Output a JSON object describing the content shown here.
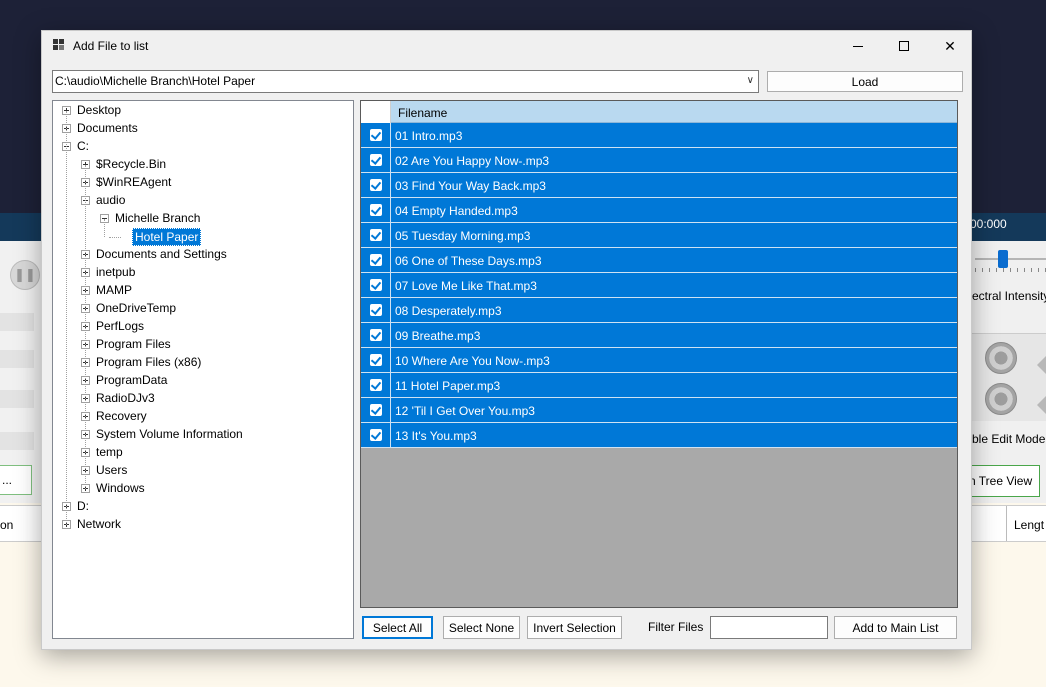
{
  "background_app": {
    "time_readout": "00:000",
    "spectral_label": "ectral Intensity",
    "edit_mode_label": "ble Edit Mode",
    "tree_view_button": "n Tree View",
    "ellipsis_button": "...",
    "column_left": "on",
    "column_right": "Lengt"
  },
  "dialog": {
    "title": "Add File to list",
    "path_value": "C:\\audio\\Michelle Branch\\Hotel Paper",
    "load_label": "Load",
    "tree": [
      {
        "label": "Desktop",
        "level": 0,
        "expander": "plus"
      },
      {
        "label": "Documents",
        "level": 0,
        "expander": "plus"
      },
      {
        "label": "C:",
        "level": 0,
        "expander": "minus"
      },
      {
        "label": "$Recycle.Bin",
        "level": 1,
        "expander": "plus"
      },
      {
        "label": "$WinREAgent",
        "level": 1,
        "expander": "plus"
      },
      {
        "label": "audio",
        "level": 1,
        "expander": "minus"
      },
      {
        "label": "Michelle Branch",
        "level": 2,
        "expander": "minus"
      },
      {
        "label": "Hotel Paper",
        "level": 3,
        "expander": "none",
        "selected": true
      },
      {
        "label": "Documents and Settings",
        "level": 1,
        "expander": "plus"
      },
      {
        "label": "inetpub",
        "level": 1,
        "expander": "plus"
      },
      {
        "label": "MAMP",
        "level": 1,
        "expander": "plus"
      },
      {
        "label": "OneDriveTemp",
        "level": 1,
        "expander": "plus"
      },
      {
        "label": "PerfLogs",
        "level": 1,
        "expander": "plus"
      },
      {
        "label": "Program Files",
        "level": 1,
        "expander": "plus"
      },
      {
        "label": "Program Files (x86)",
        "level": 1,
        "expander": "plus"
      },
      {
        "label": "ProgramData",
        "level": 1,
        "expander": "plus"
      },
      {
        "label": "RadioDJv3",
        "level": 1,
        "expander": "plus"
      },
      {
        "label": "Recovery",
        "level": 1,
        "expander": "plus"
      },
      {
        "label": "System Volume Information",
        "level": 1,
        "expander": "plus"
      },
      {
        "label": "temp",
        "level": 1,
        "expander": "plus"
      },
      {
        "label": "Users",
        "level": 1,
        "expander": "plus"
      },
      {
        "label": "Windows",
        "level": 1,
        "expander": "plus"
      },
      {
        "label": "D:",
        "level": 0,
        "expander": "plus"
      },
      {
        "label": "Network",
        "level": 0,
        "expander": "plus"
      }
    ],
    "grid": {
      "column_filename": "Filename",
      "files": [
        {
          "name": "01 Intro.mp3",
          "checked": true
        },
        {
          "name": "02 Are You Happy Now-.mp3",
          "checked": true
        },
        {
          "name": "03 Find Your Way Back.mp3",
          "checked": true
        },
        {
          "name": "04 Empty Handed.mp3",
          "checked": true
        },
        {
          "name": "05 Tuesday Morning.mp3",
          "checked": true
        },
        {
          "name": "06 One of These Days.mp3",
          "checked": true
        },
        {
          "name": "07 Love Me Like That.mp3",
          "checked": true
        },
        {
          "name": "08 Desperately.mp3",
          "checked": true
        },
        {
          "name": "09 Breathe.mp3",
          "checked": true
        },
        {
          "name": "10 Where Are You Now-.mp3",
          "checked": true
        },
        {
          "name": "11 Hotel Paper.mp3",
          "checked": true
        },
        {
          "name": "12 'Til I Get Over You.mp3",
          "checked": true
        },
        {
          "name": "13 It's You.mp3",
          "checked": true
        }
      ]
    },
    "buttons": {
      "select_all": "Select All",
      "select_none": "Select None",
      "invert_selection": "Invert Selection",
      "add_to_main_list": "Add to Main List"
    },
    "filter_label": "Filter Files",
    "filter_value": ""
  },
  "colors": {
    "selection": "#0078d7",
    "grid_empty": "#a9a9a9",
    "header": "#b9d9f0",
    "background_top": "#1d2137"
  }
}
